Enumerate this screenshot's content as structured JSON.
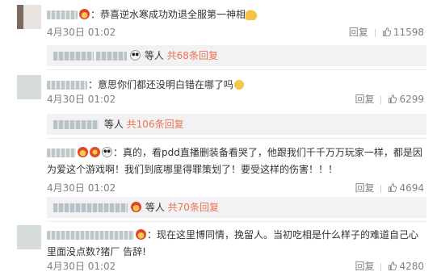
{
  "comments": [
    {
      "text": "：恭喜逆水寒成功劝退全服第一神相",
      "date": "4月30日 01:02",
      "reply_label": "回复",
      "likes": "11598",
      "sub": {
        "people": "等人",
        "count": "共68条回复"
      }
    },
    {
      "text": "：意思你们都还没明白错在哪了吗",
      "date": "4月30日 01:02",
      "reply_label": "回复",
      "likes": "6299",
      "sub": {
        "people": "等人",
        "count": "共106条回复"
      }
    },
    {
      "text": "：真的，看pdd直播删装备看哭了，他跟我们千千万万玩家一样，都是因为爱这个游戏啊！我们到底哪里得罪策划了！要受这样的伤害！！！",
      "date": "4月30日 01:02",
      "reply_label": "回复",
      "likes": "4694",
      "sub": {
        "people": "等人",
        "count": "共70条回复"
      }
    },
    {
      "text": "：现在这里博同情，挽留人。当初吃相是什么样子的难道自己心里面没点数?猪厂 告辞!",
      "date": "4月30日 01:02",
      "reply_label": "回复",
      "likes": "4280"
    }
  ],
  "icons": {
    "like": "thumbs-up-icon",
    "badge": "vip-badge-icon",
    "panda": "panda-icon"
  },
  "colors": {
    "accent": "#eb7350",
    "meta": "#808080",
    "sub_bg": "#f2f2f5"
  }
}
